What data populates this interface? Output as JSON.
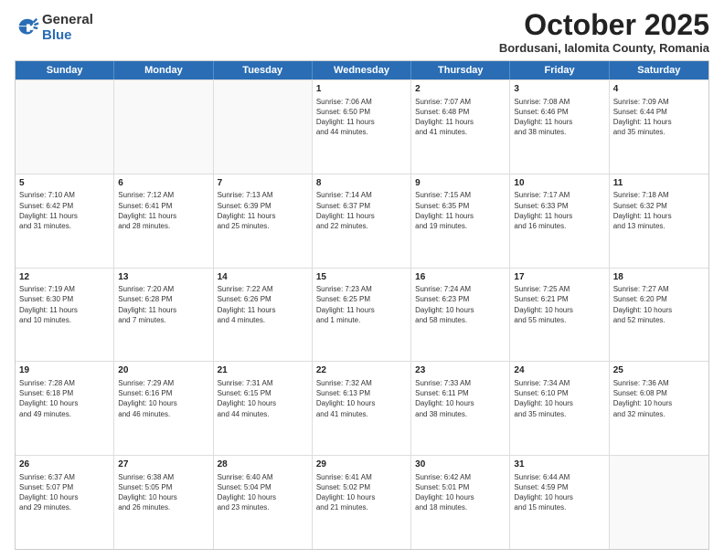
{
  "logo": {
    "general": "General",
    "blue": "Blue"
  },
  "header": {
    "month": "October 2025",
    "location": "Bordusani, Ialomita County, Romania"
  },
  "days": [
    "Sunday",
    "Monday",
    "Tuesday",
    "Wednesday",
    "Thursday",
    "Friday",
    "Saturday"
  ],
  "rows": [
    [
      {
        "day": "",
        "lines": []
      },
      {
        "day": "",
        "lines": []
      },
      {
        "day": "",
        "lines": []
      },
      {
        "day": "1",
        "lines": [
          "Sunrise: 7:06 AM",
          "Sunset: 6:50 PM",
          "Daylight: 11 hours",
          "and 44 minutes."
        ]
      },
      {
        "day": "2",
        "lines": [
          "Sunrise: 7:07 AM",
          "Sunset: 6:48 PM",
          "Daylight: 11 hours",
          "and 41 minutes."
        ]
      },
      {
        "day": "3",
        "lines": [
          "Sunrise: 7:08 AM",
          "Sunset: 6:46 PM",
          "Daylight: 11 hours",
          "and 38 minutes."
        ]
      },
      {
        "day": "4",
        "lines": [
          "Sunrise: 7:09 AM",
          "Sunset: 6:44 PM",
          "Daylight: 11 hours",
          "and 35 minutes."
        ]
      }
    ],
    [
      {
        "day": "5",
        "lines": [
          "Sunrise: 7:10 AM",
          "Sunset: 6:42 PM",
          "Daylight: 11 hours",
          "and 31 minutes."
        ]
      },
      {
        "day": "6",
        "lines": [
          "Sunrise: 7:12 AM",
          "Sunset: 6:41 PM",
          "Daylight: 11 hours",
          "and 28 minutes."
        ]
      },
      {
        "day": "7",
        "lines": [
          "Sunrise: 7:13 AM",
          "Sunset: 6:39 PM",
          "Daylight: 11 hours",
          "and 25 minutes."
        ]
      },
      {
        "day": "8",
        "lines": [
          "Sunrise: 7:14 AM",
          "Sunset: 6:37 PM",
          "Daylight: 11 hours",
          "and 22 minutes."
        ]
      },
      {
        "day": "9",
        "lines": [
          "Sunrise: 7:15 AM",
          "Sunset: 6:35 PM",
          "Daylight: 11 hours",
          "and 19 minutes."
        ]
      },
      {
        "day": "10",
        "lines": [
          "Sunrise: 7:17 AM",
          "Sunset: 6:33 PM",
          "Daylight: 11 hours",
          "and 16 minutes."
        ]
      },
      {
        "day": "11",
        "lines": [
          "Sunrise: 7:18 AM",
          "Sunset: 6:32 PM",
          "Daylight: 11 hours",
          "and 13 minutes."
        ]
      }
    ],
    [
      {
        "day": "12",
        "lines": [
          "Sunrise: 7:19 AM",
          "Sunset: 6:30 PM",
          "Daylight: 11 hours",
          "and 10 minutes."
        ]
      },
      {
        "day": "13",
        "lines": [
          "Sunrise: 7:20 AM",
          "Sunset: 6:28 PM",
          "Daylight: 11 hours",
          "and 7 minutes."
        ]
      },
      {
        "day": "14",
        "lines": [
          "Sunrise: 7:22 AM",
          "Sunset: 6:26 PM",
          "Daylight: 11 hours",
          "and 4 minutes."
        ]
      },
      {
        "day": "15",
        "lines": [
          "Sunrise: 7:23 AM",
          "Sunset: 6:25 PM",
          "Daylight: 11 hours",
          "and 1 minute."
        ]
      },
      {
        "day": "16",
        "lines": [
          "Sunrise: 7:24 AM",
          "Sunset: 6:23 PM",
          "Daylight: 10 hours",
          "and 58 minutes."
        ]
      },
      {
        "day": "17",
        "lines": [
          "Sunrise: 7:25 AM",
          "Sunset: 6:21 PM",
          "Daylight: 10 hours",
          "and 55 minutes."
        ]
      },
      {
        "day": "18",
        "lines": [
          "Sunrise: 7:27 AM",
          "Sunset: 6:20 PM",
          "Daylight: 10 hours",
          "and 52 minutes."
        ]
      }
    ],
    [
      {
        "day": "19",
        "lines": [
          "Sunrise: 7:28 AM",
          "Sunset: 6:18 PM",
          "Daylight: 10 hours",
          "and 49 minutes."
        ]
      },
      {
        "day": "20",
        "lines": [
          "Sunrise: 7:29 AM",
          "Sunset: 6:16 PM",
          "Daylight: 10 hours",
          "and 46 minutes."
        ]
      },
      {
        "day": "21",
        "lines": [
          "Sunrise: 7:31 AM",
          "Sunset: 6:15 PM",
          "Daylight: 10 hours",
          "and 44 minutes."
        ]
      },
      {
        "day": "22",
        "lines": [
          "Sunrise: 7:32 AM",
          "Sunset: 6:13 PM",
          "Daylight: 10 hours",
          "and 41 minutes."
        ]
      },
      {
        "day": "23",
        "lines": [
          "Sunrise: 7:33 AM",
          "Sunset: 6:11 PM",
          "Daylight: 10 hours",
          "and 38 minutes."
        ]
      },
      {
        "day": "24",
        "lines": [
          "Sunrise: 7:34 AM",
          "Sunset: 6:10 PM",
          "Daylight: 10 hours",
          "and 35 minutes."
        ]
      },
      {
        "day": "25",
        "lines": [
          "Sunrise: 7:36 AM",
          "Sunset: 6:08 PM",
          "Daylight: 10 hours",
          "and 32 minutes."
        ]
      }
    ],
    [
      {
        "day": "26",
        "lines": [
          "Sunrise: 6:37 AM",
          "Sunset: 5:07 PM",
          "Daylight: 10 hours",
          "and 29 minutes."
        ]
      },
      {
        "day": "27",
        "lines": [
          "Sunrise: 6:38 AM",
          "Sunset: 5:05 PM",
          "Daylight: 10 hours",
          "and 26 minutes."
        ]
      },
      {
        "day": "28",
        "lines": [
          "Sunrise: 6:40 AM",
          "Sunset: 5:04 PM",
          "Daylight: 10 hours",
          "and 23 minutes."
        ]
      },
      {
        "day": "29",
        "lines": [
          "Sunrise: 6:41 AM",
          "Sunset: 5:02 PM",
          "Daylight: 10 hours",
          "and 21 minutes."
        ]
      },
      {
        "day": "30",
        "lines": [
          "Sunrise: 6:42 AM",
          "Sunset: 5:01 PM",
          "Daylight: 10 hours",
          "and 18 minutes."
        ]
      },
      {
        "day": "31",
        "lines": [
          "Sunrise: 6:44 AM",
          "Sunset: 4:59 PM",
          "Daylight: 10 hours",
          "and 15 minutes."
        ]
      },
      {
        "day": "",
        "lines": []
      }
    ]
  ]
}
